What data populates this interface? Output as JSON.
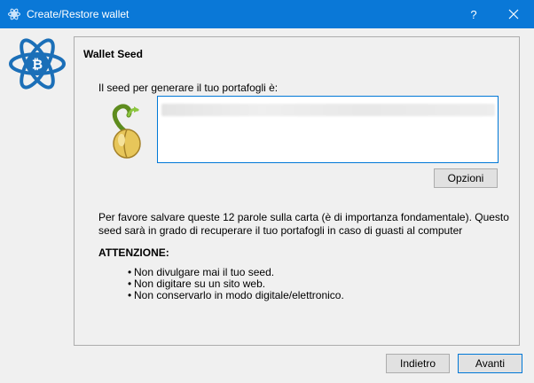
{
  "window": {
    "title": "Create/Restore wallet",
    "help_label": "?",
    "accent": "#0a78d7"
  },
  "icons": {
    "app": "electrum-app-icon",
    "logo": "electrum-bitcoin-logo",
    "close": "close-icon",
    "seed": "seed-sprout-image"
  },
  "panel": {
    "title": "Wallet Seed",
    "seed_label": "Il seed per generare il tuo portafogli è:",
    "seed_value": "",
    "options_label": "Opzioni",
    "warning_text": "Per favore salvare queste 12 parole sulla carta (è di importanza fondamentale). Questo seed sarà in grado di recuperare il tuo portafogli in caso di guasti al computer",
    "attention_title": "ATTENZIONE:",
    "bullets": [
      "Non divulgare mai il tuo seed.",
      "Non digitare su un sito web.",
      "Non conservarlo in modo digitale/elettronico."
    ]
  },
  "footer": {
    "back_label": "Indietro",
    "next_label": "Avanti"
  }
}
